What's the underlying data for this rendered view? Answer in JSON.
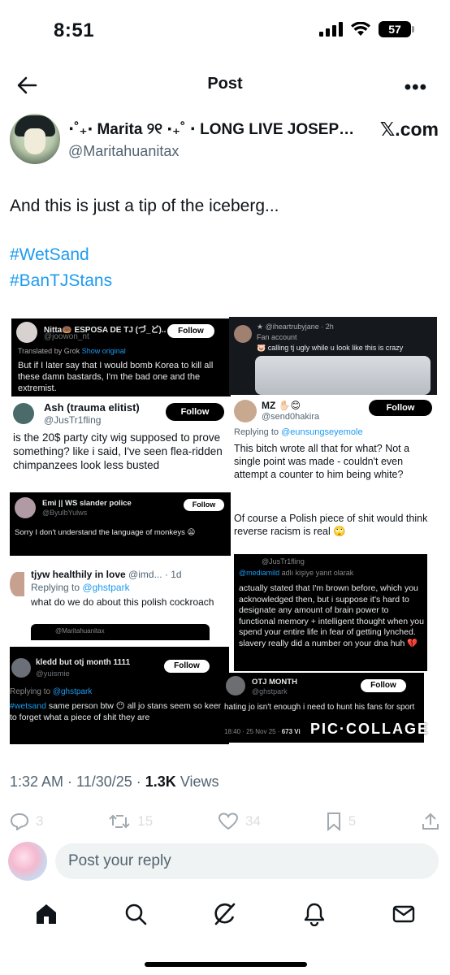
{
  "status_bar": {
    "time": "8:51",
    "battery": "57"
  },
  "header": {
    "title": "Post"
  },
  "author": {
    "display_name": "⋅˚₊‧ Marita ୨୧ ‧₊˚ ⋅ LONG LIVE JOSEPH...",
    "handle": "@Maritahuanitax",
    "source_badge": "𝕏.com"
  },
  "post": {
    "text": "And this is just a tip of the iceberg...",
    "hashtags": [
      "#WetSand",
      "#BanTJStans"
    ]
  },
  "collage": {
    "watermark": "PIC·COLLAGE",
    "c1": {
      "name": "Nitta🍩 ESPOSA DE TJ (づ_ど)...",
      "handle": "@joowon_nt",
      "follow": "Follow",
      "translated": "Translated by Grok",
      "show_original": "Show original",
      "text": "But if I later say that I would bomb Korea to kill all these damn bastards, I'm the bad one and the extremist."
    },
    "c2": {
      "name": "★ @iheartrubyjane · 2h",
      "sub": "Fan account",
      "text": "🐷 calling tj ugly while u look like this is crazy"
    },
    "c3": {
      "name": "Ash (trauma elitist)",
      "handle": "@JusTr1fling",
      "follow": "Follow",
      "text": "is the 20$ party city wig supposed to prove something? like i said, I've seen flea-ridden chimpanzees look less busted"
    },
    "c4": {
      "name": "MZ ✋🏻😊",
      "handle": "@send0hakira",
      "follow": "Follow",
      "replying": "Replying to",
      "replying_to": "@eunsungseyemole",
      "text1": "This bitch wrote all that for what? Not a single point was made - couldn't even attempt a counter to him being white?",
      "text2": "Of course a Polish piece of shit would think reverse racism is real 🙄"
    },
    "c5": {
      "name": "Emi || WS slander police",
      "handle": "@ByulbYulws",
      "follow": "Follow",
      "text": "Sorry I don't understand the language of monkeys 😦"
    },
    "c6": {
      "name": "tjyw healthily in love",
      "handle": "@imd...",
      "time": "· 1d",
      "replying": "Replying to",
      "replying_to": "@ghstpark",
      "text": "what do we do about this polish cockroach",
      "quoted": "@Maritahuanitax"
    },
    "c7": {
      "handle": "@JusTr1fling",
      "mention": "@mediamild",
      "mention_suffix": "adlı kişiye yanıt olarak",
      "text": "actually stated that I'm brown before, which you acknowledged then, but i suppose it's hard to designate any amount of brain power to functional memory + intelligent thought when you spend your entire life in fear of getting lynched. slavery really did a number on your dna huh 💔"
    },
    "c8": {
      "name": "kledd but otj month 1111",
      "handle": "@yuismie",
      "follow": "Follow",
      "replying": "Replying to",
      "replying_to": "@ghstpark",
      "tag": "#wetsand",
      "text": "same person btw 😶 all jo stans seem so keen to forget what a piece of shit they are"
    },
    "c9": {
      "name": "OTJ MONTH",
      "handle": "@ghstpark",
      "follow": "Follow",
      "text": "hating jo isn't enough i need to hunt his fans for sport",
      "meta": "18:40 · 25 Nov 25 ·",
      "views": "673 Vi"
    }
  },
  "meta": {
    "time": "1:32 AM · 11/30/25 ·",
    "views_count": "1.3K",
    "views_label": "Views"
  },
  "actions": {
    "replies": "3",
    "reposts": "15",
    "likes": "34",
    "bookmarks": "5"
  },
  "reply": {
    "placeholder": "Post your reply"
  },
  "tabbar": [
    "home-icon",
    "search-icon",
    "grok-icon",
    "notifications-icon",
    "messages-icon"
  ]
}
